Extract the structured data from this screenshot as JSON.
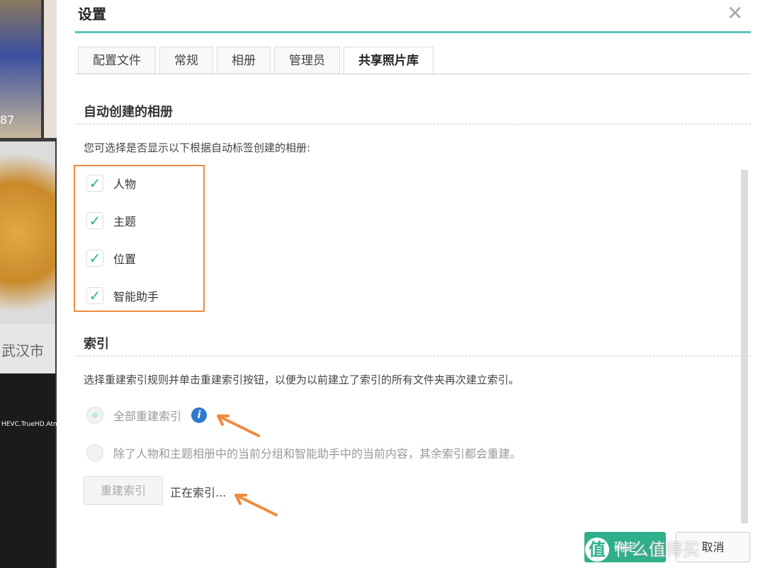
{
  "background": {
    "count_text": "87",
    "city": "武汉市",
    "video_text": "HEVC.TrueHD.Atmo"
  },
  "dialog": {
    "title": "设置",
    "close_icon": "close-icon",
    "tabs": [
      "配置文件",
      "常规",
      "相册",
      "管理员",
      "共享照片库"
    ],
    "active_tab": "共享照片库",
    "auto_albums": {
      "heading": "自动创建的相册",
      "description": "您可选择是否显示以下根据自动标签创建的相册:",
      "items": [
        {
          "label": "人物",
          "checked": true
        },
        {
          "label": "主题",
          "checked": true
        },
        {
          "label": "位置",
          "checked": true
        },
        {
          "label": "智能助手",
          "checked": true
        }
      ]
    },
    "index": {
      "heading": "索引",
      "description": "选择重建索引规则并单击重建索引按钮，以便为以前建立了索引的所有文件夹再次建立索引。",
      "options": [
        {
          "label": "全部重建索引",
          "selected": true
        },
        {
          "label": "除了人物和主题相册中的当前分组和智能助手中的当前内容，其余索引都会重建。",
          "selected": false
        }
      ],
      "rebuild_button": "重建索引",
      "status": "正在索引..."
    },
    "ok_button": "确定",
    "cancel_button": "取消"
  },
  "watermark": {
    "badge": "值",
    "text": "什么值得买"
  },
  "colors": {
    "accent": "#2fb08a",
    "highlight": "#f08a3c"
  }
}
